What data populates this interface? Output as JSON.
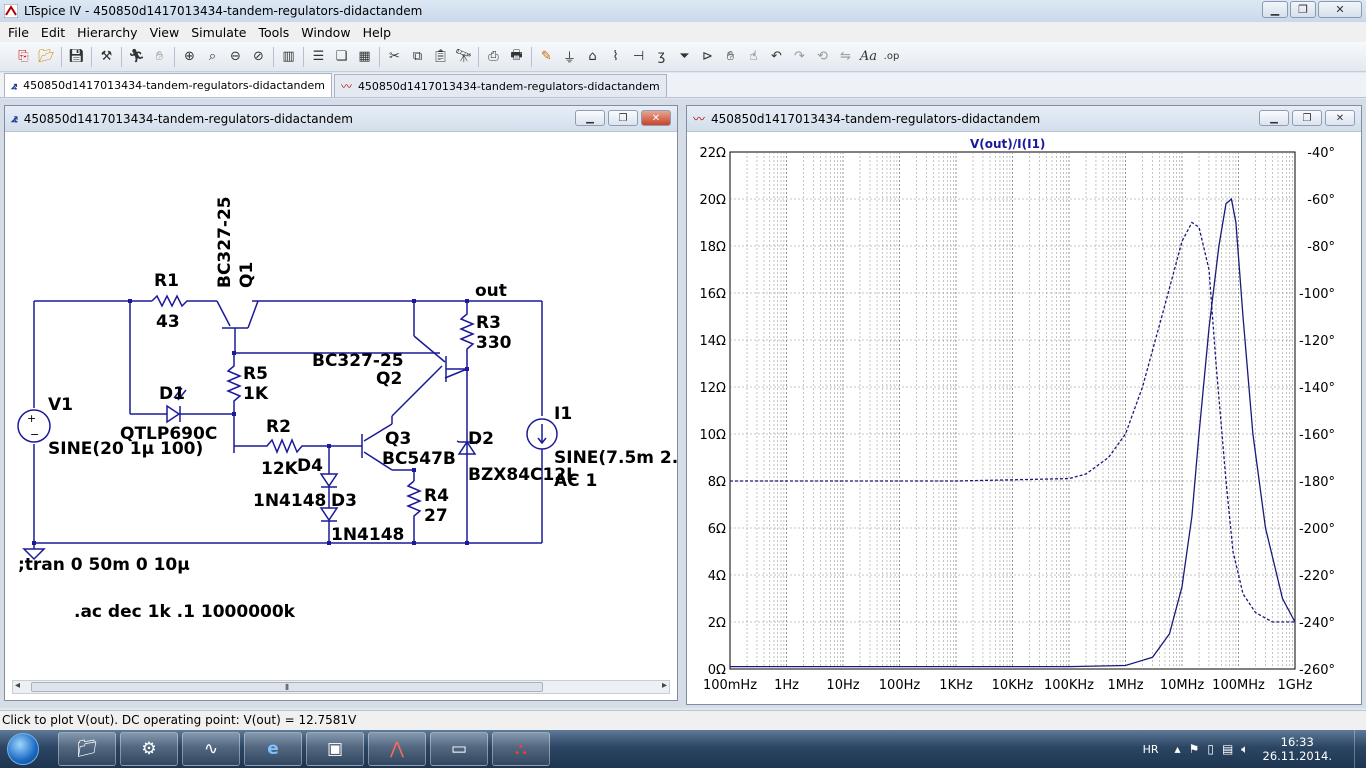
{
  "window": {
    "title": "LTspice IV - 450850d1417013434-tandem-regulators-didactandem"
  },
  "menu": [
    {
      "label": "File"
    },
    {
      "label": "Edit"
    },
    {
      "label": "Hierarchy"
    },
    {
      "label": "View"
    },
    {
      "label": "Simulate"
    },
    {
      "label": "Tools"
    },
    {
      "label": "Window"
    },
    {
      "label": "Help"
    }
  ],
  "tabs": [
    {
      "label": "450850d1417013434-tandem-regulators-didactandem"
    },
    {
      "label": "450850d1417013434-tandem-regulators-didactandem"
    }
  ],
  "schematic": {
    "title": "450850d1417013434-tandem-regulators-didactandem",
    "labels": {
      "q1_model": "BC327-25",
      "q1": "Q1",
      "r1": "R1",
      "r1_val": "43",
      "out": "out",
      "r3": "R3",
      "r3_val": "330",
      "q2_model": "BC327-25",
      "q2": "Q2",
      "r5": "R5",
      "r5_val": "1K",
      "d1": "D1",
      "d1_model": "QTLP690C",
      "v1": "V1",
      "v1_val": "SINE(20 1µ 100)",
      "i1": "I1",
      "i1_val": "SINE(7.5m 2.",
      "i1_ac": "AC 1",
      "r2": "R2",
      "r2_val": "12K",
      "q3": "Q3",
      "q3_model": "BC547B",
      "d2": "D2",
      "d2_model": "BZX84C12L",
      "d4": "D4",
      "d4_model": "1N4148",
      "d3": "D3",
      "d3_model": "1N4148",
      "r4": "R4",
      "r4_val": "27",
      "tran": ";tran 0 50m 0 10µ",
      "ac": ".ac dec 1k .1 1000000k"
    }
  },
  "plot": {
    "title": "450850d1417013434-tandem-regulators-didactandem",
    "trace_label": "V(out)/I(I1)"
  },
  "chart_data": {
    "type": "line",
    "title": "V(out)/I(I1)",
    "x_scale": "log",
    "x_ticks": [
      "100mHz",
      "1Hz",
      "10Hz",
      "100Hz",
      "1KHz",
      "10KHz",
      "100KHz",
      "1MHz",
      "10MHz",
      "100MHz",
      "1GHz"
    ],
    "y_ticks": [
      "0Ω",
      "2Ω",
      "4Ω",
      "6Ω",
      "8Ω",
      "10Ω",
      "12Ω",
      "14Ω",
      "16Ω",
      "18Ω",
      "20Ω",
      "22Ω"
    ],
    "y2_ticks": [
      "-260°",
      "-240°",
      "-220°",
      "-200°",
      "-180°",
      "-160°",
      "-140°",
      "-120°",
      "-100°",
      "-80°",
      "-60°",
      "-40°"
    ],
    "xlim_hz": [
      0.1,
      1000000000
    ],
    "ylim": [
      0,
      22
    ],
    "y2lim": [
      -260,
      -40
    ],
    "grid": true,
    "series": [
      {
        "style": "solid",
        "axis": "magnitude",
        "x": [
          0.1,
          100000,
          1000000,
          3000000,
          6000000,
          10000000,
          15000000,
          20000000,
          30000000,
          45000000,
          60000000,
          75000000,
          90000000,
          120000000,
          180000000,
          300000000,
          600000000,
          1000000000
        ],
        "y": [
          0.1,
          0.1,
          0.15,
          0.5,
          1.5,
          3.5,
          6.5,
          10,
          14.5,
          18,
          19.8,
          20,
          19,
          15,
          10,
          6,
          3,
          2
        ]
      },
      {
        "style": "dashed",
        "axis": "phase",
        "x": [
          0.1,
          1000,
          100000,
          200000,
          500000,
          1000000,
          2000000,
          5000000,
          10000000,
          15000000,
          20000000,
          30000000,
          40000000,
          60000000,
          80000000,
          120000000,
          200000000,
          400000000,
          1000000000
        ],
        "y": [
          -180,
          -180,
          -179,
          -177,
          -170,
          -160,
          -140,
          -105,
          -78,
          -70,
          -72,
          -90,
          -130,
          -180,
          -210,
          -228,
          -236,
          -240,
          -240
        ]
      }
    ]
  },
  "status": {
    "text": "Click to plot V(out).  DC operating point: V(out) = 12.7581V"
  },
  "taskbar": {
    "lang": "HR",
    "time": "16:33",
    "date": "26.11.2014."
  }
}
